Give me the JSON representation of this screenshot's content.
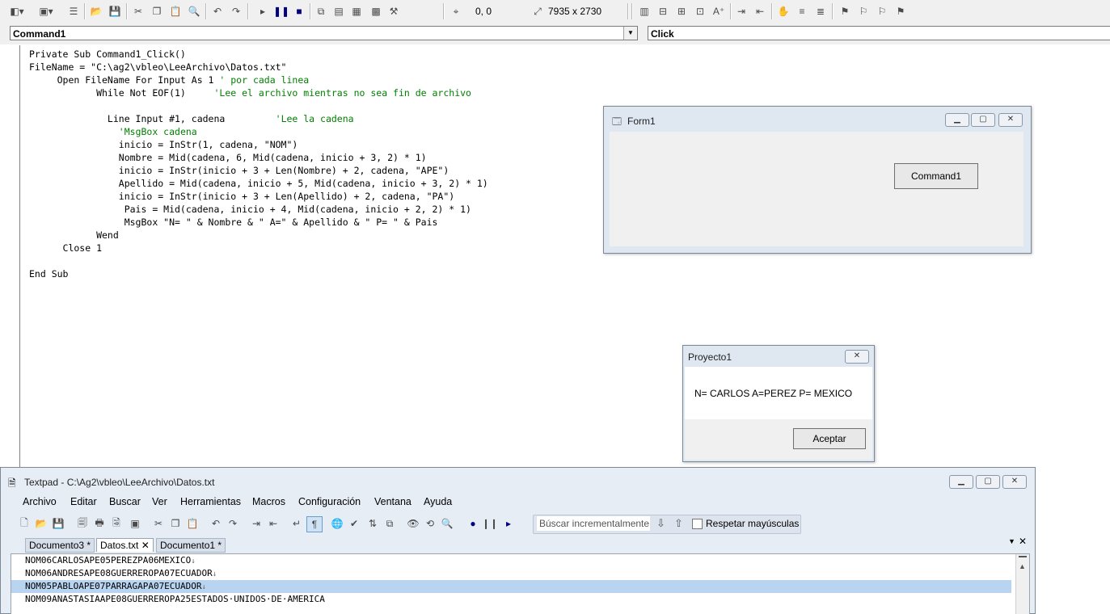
{
  "toolbar": {
    "position_readout": "0, 0",
    "size_readout": "7935 x 2730"
  },
  "combos": {
    "object": "Command1",
    "procedure": "Click"
  },
  "code": [
    {
      "text": "Private Sub Command1_Click()",
      "comment": ""
    },
    {
      "text": "FileName = \"C:\\ag2\\vbleo\\LeeArchivo\\Datos.txt\"",
      "comment": ""
    },
    {
      "text": "     Open FileName For Input As 1 ",
      "comment": "' por cada linea"
    },
    {
      "text": "            While Not EOF(1)     ",
      "comment": "'Lee el archivo mientras no sea fin de archivo"
    },
    {
      "text": "",
      "comment": ""
    },
    {
      "text": "              Line Input #1, cadena         ",
      "comment": "'Lee la cadena"
    },
    {
      "text": "                ",
      "comment": "'MsgBox cadena"
    },
    {
      "text": "                inicio = InStr(1, cadena, \"NOM\")",
      "comment": ""
    },
    {
      "text": "                Nombre = Mid(cadena, 6, Mid(cadena, inicio + 3, 2) * 1)",
      "comment": ""
    },
    {
      "text": "                inicio = InStr(inicio + 3 + Len(Nombre) + 2, cadena, \"APE\")",
      "comment": ""
    },
    {
      "text": "                Apellido = Mid(cadena, inicio + 5, Mid(cadena, inicio + 3, 2) * 1)",
      "comment": ""
    },
    {
      "text": "                inicio = InStr(inicio + 3 + Len(Apellido) + 2, cadena, \"PA\")",
      "comment": ""
    },
    {
      "text": "                 Pais = Mid(cadena, inicio + 4, Mid(cadena, inicio + 2, 2) * 1)",
      "comment": ""
    },
    {
      "text": "                 MsgBox \"N= \" & Nombre & \" A=\" & Apellido & \" P= \" & Pais",
      "comment": ""
    },
    {
      "text": "            Wend",
      "comment": ""
    },
    {
      "text": "      Close 1",
      "comment": ""
    },
    {
      "text": "",
      "comment": ""
    },
    {
      "text": "End Sub",
      "comment": ""
    }
  ],
  "form1": {
    "title": "Form1",
    "button_label": "Command1"
  },
  "msgbox": {
    "title": "Proyecto1",
    "message": "N= CARLOS A=PEREZ P= MEXICO",
    "ok_label": "Aceptar"
  },
  "textpad": {
    "title": "Textpad - C:\\Ag2\\vbleo\\LeeArchivo\\Datos.txt",
    "menu": [
      "Archivo",
      "Editar",
      "Buscar",
      "Ver",
      "Herramientas",
      "Macros",
      "Configuración",
      "Ventana",
      "Ayuda"
    ],
    "search_placeholder": "Búscar incrementalmente",
    "match_case_label": "Respetar mayúsculas",
    "tabs": [
      "Documento3 *",
      "Datos.txt",
      "Documento1 *"
    ],
    "lines": [
      "NOM06CARLOSAPE05PEREZPA06MEXICO",
      "NOM06ANDRESAPE08GUERREROPA07ECUADOR",
      "NOM05PABLOAPE07PARRAGAPA07ECUADOR",
      "NOM09ANASTASIAAPE08GUERREROPA25ESTADOS·UNIDOS·DE·AMERICA"
    ],
    "selected_line": 2
  }
}
